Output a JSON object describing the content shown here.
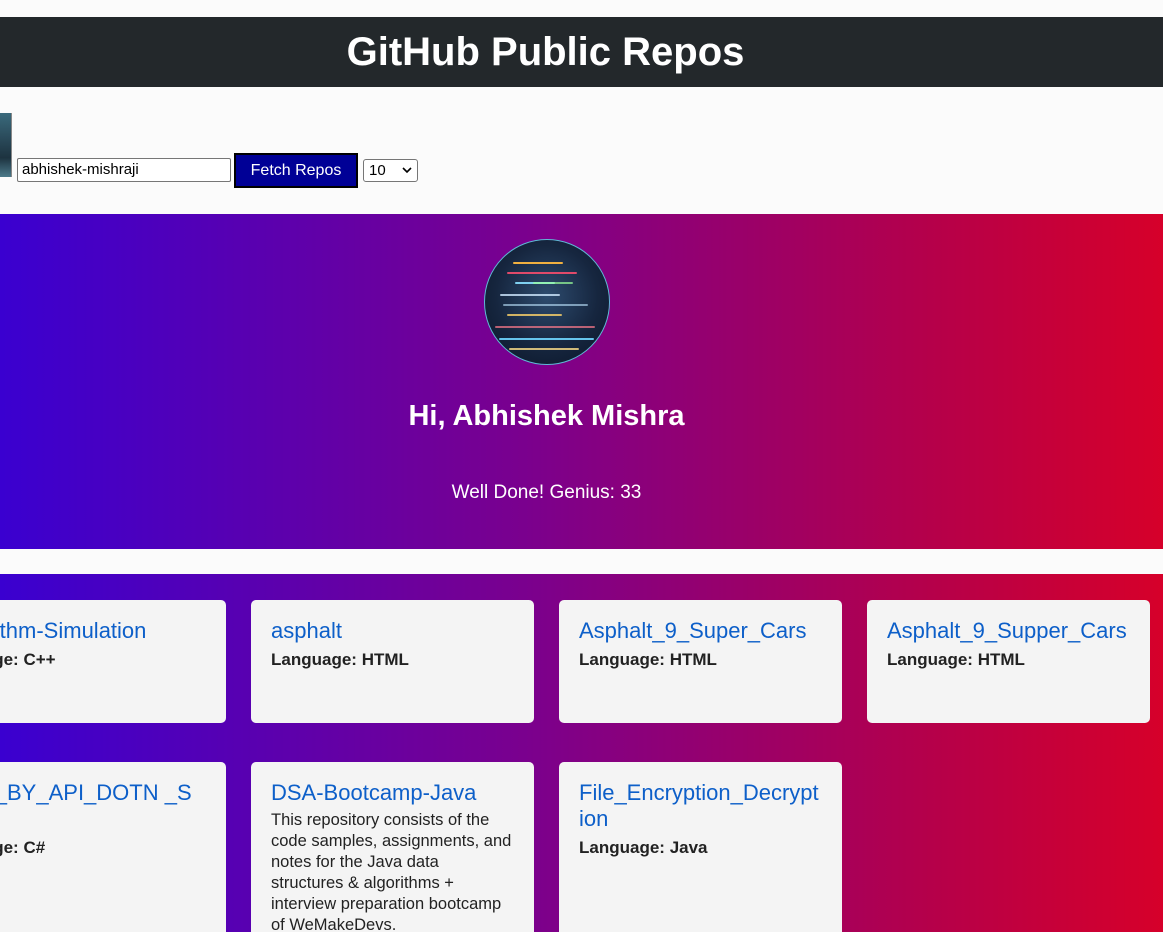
{
  "header": {
    "title": "GitHub Public Repos"
  },
  "controls": {
    "username_value": "abhishek-mishraji",
    "fetch_label": "Fetch Repos",
    "per_page_value": "10"
  },
  "profile": {
    "greeting": "Hi, Abhishek Mishra",
    "subtitle": "Well Done! Genius: 33"
  },
  "repos": [
    {
      "name": "gorithm-Simulation",
      "language_label": "guage:",
      "language": "C++",
      "description": ""
    },
    {
      "name": "asphalt",
      "language_label": "Language:",
      "language": "HTML",
      "description": ""
    },
    {
      "name": "Asphalt_9_Super_Cars",
      "language_label": "Language:",
      "language": "HTML",
      "description": ""
    },
    {
      "name": "Asphalt_9_Supper_Cars",
      "language_label": "Language:",
      "language": "HTML",
      "description": ""
    },
    {
      "name": "UD_BY_API_DOTN _SQL",
      "language_label": "guage:",
      "language": "C#",
      "description": ""
    },
    {
      "name": "DSA-Bootcamp-Java",
      "language_label": "",
      "language": "",
      "description": "This repository consists of the code samples, assignments, and notes for the Java data structures & algorithms + interview preparation bootcamp of WeMakeDevs."
    },
    {
      "name": "File_Encryption_Decryption",
      "language_label": "Language:",
      "language": "Java",
      "description": ""
    }
  ]
}
